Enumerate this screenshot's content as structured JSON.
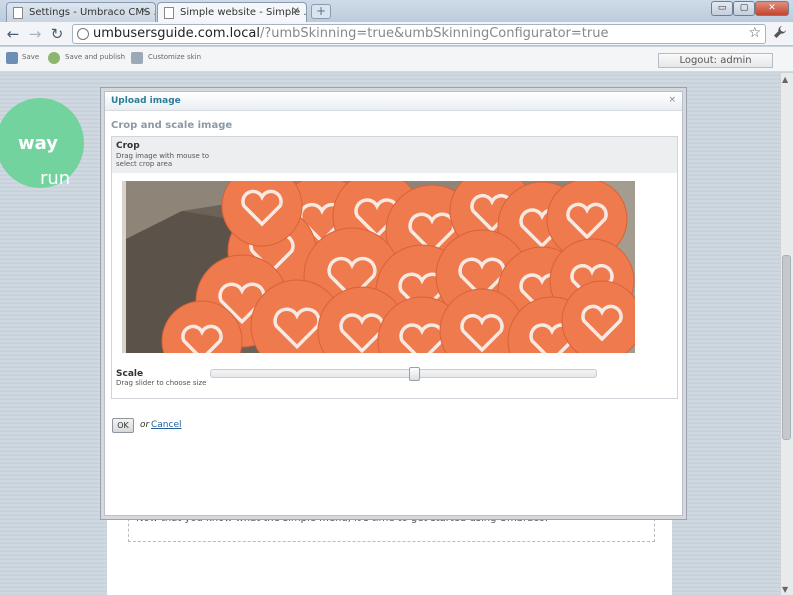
{
  "browser": {
    "tabs": [
      {
        "title": "Settings - Umbraco CMS ...",
        "active": false
      },
      {
        "title": "Simple website - Simple ...",
        "active": true
      }
    ],
    "new_tab_icon": "plus-icon",
    "window_buttons": {
      "minimize": "▭",
      "maximize": "▢",
      "close": "✕"
    },
    "url_host": "umbusersguide.com.local",
    "url_path": "/?umbSkinning=true&umbSkinningConfigurator=true",
    "star": "☆",
    "wrench": "🔧"
  },
  "toolbar": {
    "save_label": "Save",
    "save_publish_label": "Save and publish",
    "customize_label": "Customize skin",
    "logout_label": "Logout: admin"
  },
  "page": {
    "logo_light": "run",
    "logo_bold": "way",
    "body_text": "Now that you know what the simple menu, it's time to get started using Umbraco."
  },
  "modal": {
    "title": "Upload image",
    "close": "×",
    "section_title": "Crop and scale image",
    "crop_label": "Crop",
    "crop_hint": "Drag image with mouse to select crop area",
    "scale_label": "Scale",
    "scale_hint": "Drag slider to choose size",
    "scale_value": 0.53,
    "ok_label": "OK",
    "or_text": "or",
    "cancel_label": "Cancel"
  },
  "colors": {
    "accent": "#2d7d97",
    "logo": "#73d39f",
    "disc": "#ee7a4e"
  }
}
